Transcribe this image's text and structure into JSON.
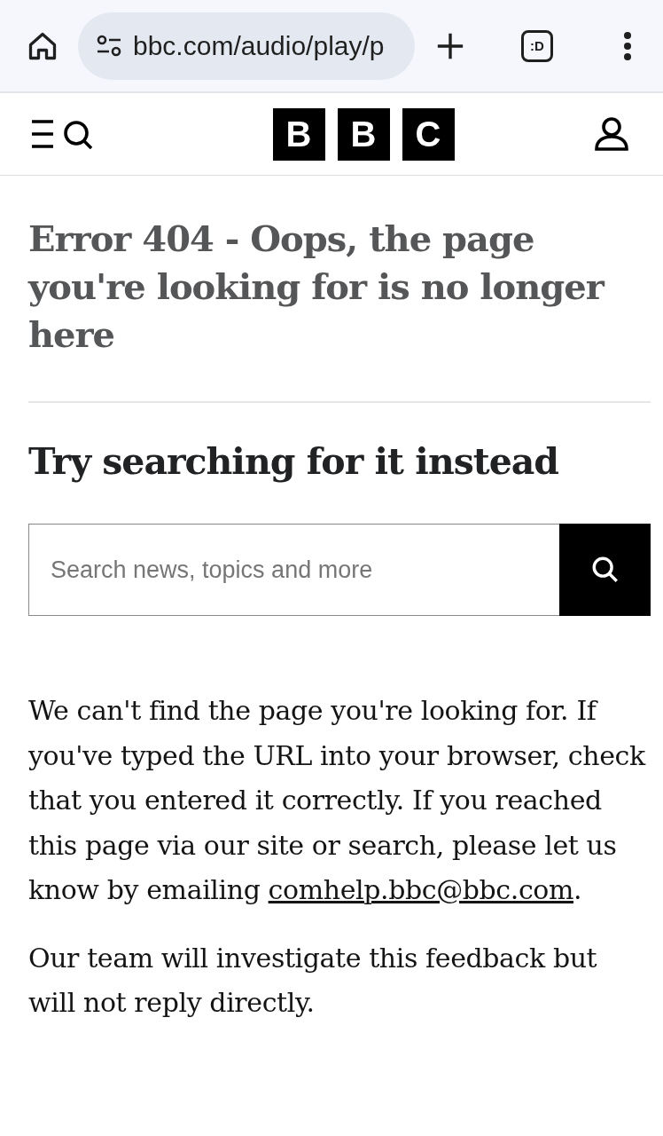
{
  "browser": {
    "url": "bbc.com/audio/play/p",
    "tab_switcher": ":D"
  },
  "header": {
    "logo_letters": [
      "B",
      "B",
      "C"
    ]
  },
  "error_title": "Error 404 - Oops, the page you're looking for is no longer here",
  "search_section": {
    "heading": "Try searching for it instead",
    "placeholder": "Search news, topics and more"
  },
  "message": {
    "text_before": "We can't find the page you're looking for. If you've typed the URL into your browser, check that you entered it correctly. If you reached this page via our site or search, please let us know by emailing ",
    "link": "comhelp.bbc@bbc.com",
    "text_after": "."
  },
  "note": "Our team will investigate this feedback but will not reply directly."
}
